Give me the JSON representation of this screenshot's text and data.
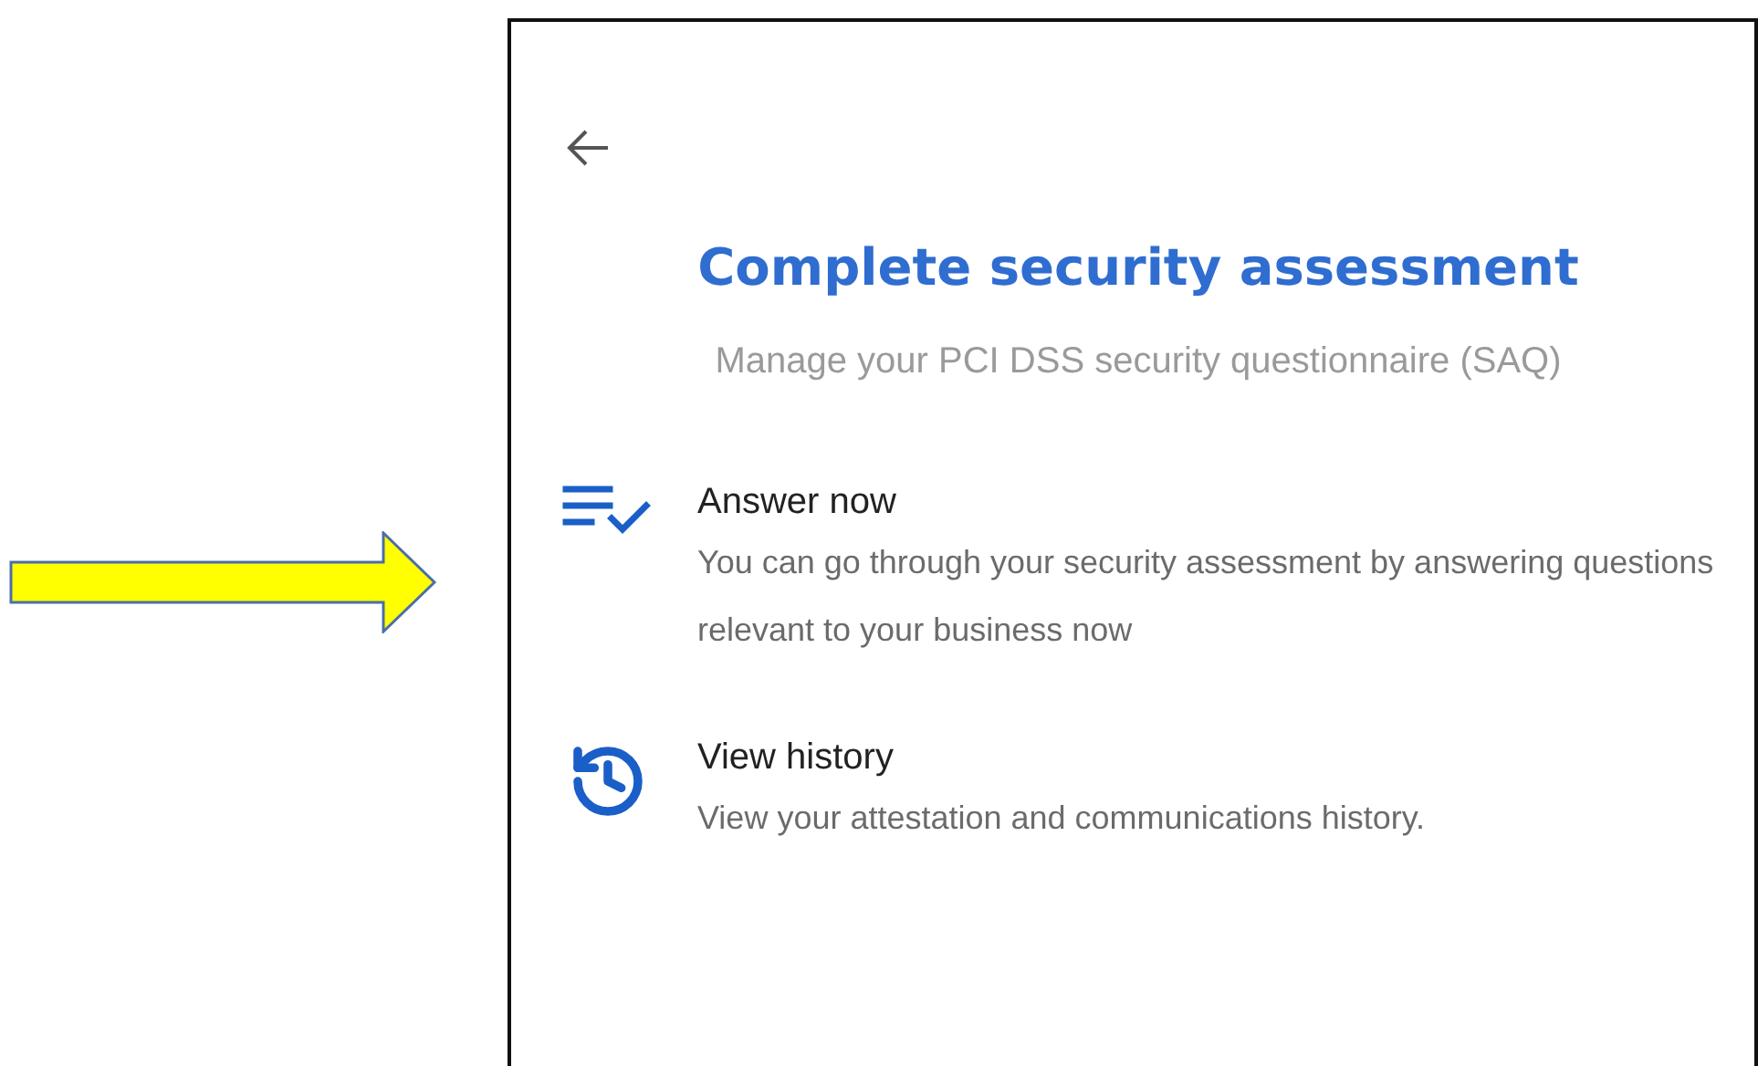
{
  "panel": {
    "title": "Complete security assessment",
    "subtitle": "Manage your PCI DSS security questionnaire (SAQ)",
    "options": [
      {
        "kind": "answer",
        "title": "Answer now",
        "description": "You can go through your security assessment by answering questions relevant to your business now"
      },
      {
        "kind": "history",
        "title": "View history",
        "description": "View your attestation and communications history."
      }
    ]
  }
}
